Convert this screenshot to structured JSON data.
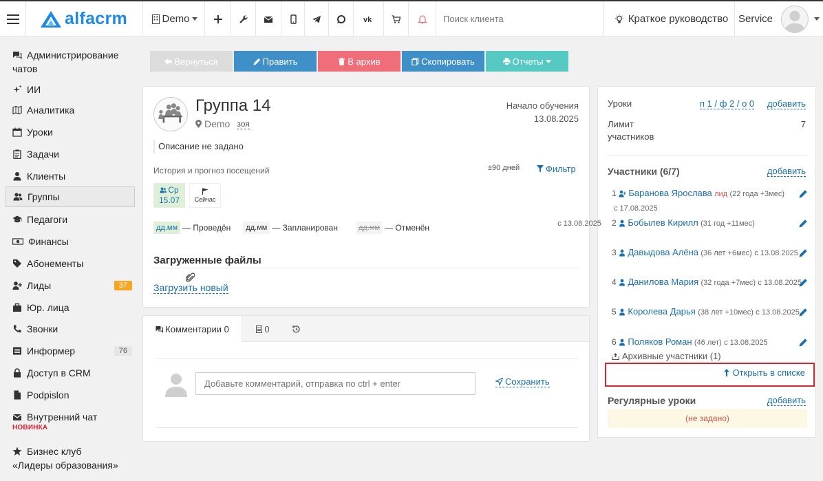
{
  "topbar": {
    "logo_text": "alfacrm",
    "branch": "Demo",
    "search_placeholder": "Поиск клиента",
    "guide_label": "Краткое руководство",
    "user_name": "Service"
  },
  "sidebar": {
    "items": [
      {
        "label": "Администрирование",
        "label2": "чатов",
        "icon": "chat-icon"
      },
      {
        "label": "ИИ",
        "icon": "sparkle-icon"
      },
      {
        "label": "Аналитика",
        "icon": "map-icon"
      },
      {
        "label": "Уроки",
        "icon": "calendar-icon"
      },
      {
        "label": "Задачи",
        "icon": "clipboard-icon"
      },
      {
        "label": "Клиенты",
        "icon": "user-icon"
      },
      {
        "label": "Группы",
        "icon": "users-icon"
      },
      {
        "label": "Педагоги",
        "icon": "graduation-icon"
      },
      {
        "label": "Финансы",
        "icon": "money-icon"
      },
      {
        "label": "Абонементы",
        "icon": "tag-icon"
      },
      {
        "label": "Лиды",
        "icon": "user-plus-icon",
        "badge": "37"
      },
      {
        "label": "Юр. лица",
        "icon": "briefcase-icon"
      },
      {
        "label": "Звонки",
        "icon": "phone-icon"
      },
      {
        "label": "Информер",
        "icon": "list-icon",
        "badge": "76"
      },
      {
        "label": "Доступ в CRM",
        "icon": "lock-icon"
      },
      {
        "label": "Podpislon",
        "icon": "file-icon"
      },
      {
        "label": "Внутренний чат",
        "icon": "mail-icon",
        "sub": "НОВИНКА"
      },
      {
        "label": "Бизнес клуб",
        "label2": "«Лидеры образования»",
        "icon": "star-icon"
      }
    ]
  },
  "toolbar": {
    "back": "Вернуться",
    "edit": "Править",
    "archive": "В архив",
    "copy": "Скопировать",
    "reports": "Отчеты"
  },
  "group": {
    "title": "Группа 14",
    "branch": "Demo",
    "room": "зоя",
    "start_label": "Начало обучения",
    "start_date": "13.08.2025",
    "description": "Описание не задано",
    "history_label": "История и прогноз посещений",
    "range_label": "±90 дней",
    "filter_label": "Фильтр",
    "day_name": "Ср",
    "day_date": "15.07",
    "now_label": "Сейчас",
    "legend_code": "дд.мм",
    "legend_done": "— Проведён",
    "legend_planned": "— Запланирован",
    "legend_cancelled": "— Отменён",
    "files_title": "Загруженные файлы",
    "upload_label": "Загрузить новый"
  },
  "comments": {
    "tab_comments": "Комментарии 0",
    "tab_docs_count": "0",
    "placeholder": "Добавьте комментарий, отправка по ctrl + enter",
    "save_label": "Сохранить"
  },
  "right": {
    "lessons_label": "Уроки",
    "lessons_value": "п 1 / ф 2 / о 0",
    "add_label": "добавить",
    "limit_label": "Лимит",
    "limit_label2": "участников",
    "limit_value": "7",
    "members_title": "Участники (6/7)",
    "members": [
      {
        "num": "1",
        "name": "Баранова Ярослава",
        "lead": "лид",
        "meta": "(22 года +3мес)",
        "since": "с 17.08.2025"
      },
      {
        "num": "2",
        "name": "Бобылев Кирилл",
        "lead": "",
        "meta": "(31 год +11мес)",
        "since": "с 13.08.2025"
      },
      {
        "num": "3",
        "name": "Давыдова Алёна",
        "lead": "",
        "meta": "(36 лет +6мес)",
        "since": "с 13.08.2025"
      },
      {
        "num": "4",
        "name": "Данилова Мария",
        "lead": "",
        "meta": "(32 года +7мес)",
        "since": "с 13.08.2025"
      },
      {
        "num": "5",
        "name": "Королева Дарья",
        "lead": "",
        "meta": "(38 лет +10мес)",
        "since": "с 13.08.2025"
      },
      {
        "num": "6",
        "name": "Поляков Роман",
        "lead": "",
        "meta": "(46 лет)",
        "since": "с 13.08.2025"
      }
    ],
    "archived_label": "Архивные участники (1)",
    "open_list_label": "Открыть в списке",
    "regular_title": "Регулярные уроки",
    "regular_empty": "(не задано)"
  },
  "colors": {
    "back_btn": "#dcdcdc",
    "edit_btn": "#3f8fc9",
    "archive_btn": "#f06e7a",
    "copy_btn": "#3f8fc9",
    "reports_btn": "#56c9c2",
    "link": "#1a6fb0",
    "lead_badge": "#f5a623",
    "highlight_box": "#d9232e"
  }
}
